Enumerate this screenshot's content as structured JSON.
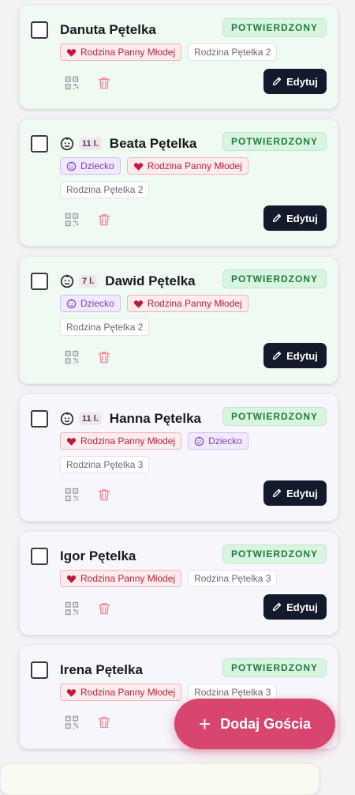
{
  "guests": [
    {
      "name": "Danuta Pętelka",
      "status": "POTWIERDZONY",
      "is_child": false,
      "age": "",
      "tags": [
        {
          "type": "family",
          "text": "Rodzina Panny Młodej"
        },
        {
          "type": "group",
          "text": "Rodzina Pętelka 2"
        }
      ],
      "theme": "green"
    },
    {
      "name": "Beata Pętelka",
      "status": "POTWIERDZONY",
      "is_child": true,
      "age": "11 l.",
      "tags": [
        {
          "type": "child",
          "text": "Dziecko"
        },
        {
          "type": "family",
          "text": "Rodzina Panny Młodej"
        },
        {
          "type": "group",
          "text": "Rodzina Pętelka 2"
        }
      ],
      "theme": "green"
    },
    {
      "name": "Dawid Pętelka",
      "status": "POTWIERDZONY",
      "is_child": true,
      "age": "7 l.",
      "tags": [
        {
          "type": "child",
          "text": "Dziecko"
        },
        {
          "type": "family",
          "text": "Rodzina Panny Młodej"
        },
        {
          "type": "group",
          "text": "Rodzina Pętelka 2"
        }
      ],
      "theme": "green"
    },
    {
      "name": "Hanna Pętelka",
      "status": "POTWIERDZONY",
      "is_child": true,
      "age": "11 l.",
      "tags": [
        {
          "type": "family",
          "text": "Rodzina Panny Młodej"
        },
        {
          "type": "child",
          "text": "Dziecko"
        },
        {
          "type": "group",
          "text": "Rodzina Pętelka 3"
        }
      ],
      "theme": "lilac"
    },
    {
      "name": "Igor Pętelka",
      "status": "POTWIERDZONY",
      "is_child": false,
      "age": "",
      "tags": [
        {
          "type": "family",
          "text": "Rodzina Panny Młodej"
        },
        {
          "type": "group",
          "text": "Rodzina Pętelka 3"
        }
      ],
      "theme": "lilac"
    },
    {
      "name": "Irena Pętelka",
      "status": "POTWIERDZONY",
      "is_child": false,
      "age": "",
      "tags": [
        {
          "type": "family",
          "text": "Rodzina Panny Młodej"
        },
        {
          "type": "group",
          "text": "Rodzina Pętelka 3"
        }
      ],
      "theme": "lilac"
    }
  ],
  "actions": {
    "edit_label": "Edytuj",
    "qr_icon": "qr-code-icon",
    "delete_icon": "trash-icon"
  },
  "fab": {
    "label": "Dodaj Gościa",
    "plus": "+"
  },
  "colors": {
    "status_bg": "#d9f5e1",
    "status_text": "#1f7a3d",
    "edit_button": "#141a2b",
    "fab": "#d8456f",
    "family_tag": "#b4233a",
    "child_tag": "#7a3fc1"
  }
}
